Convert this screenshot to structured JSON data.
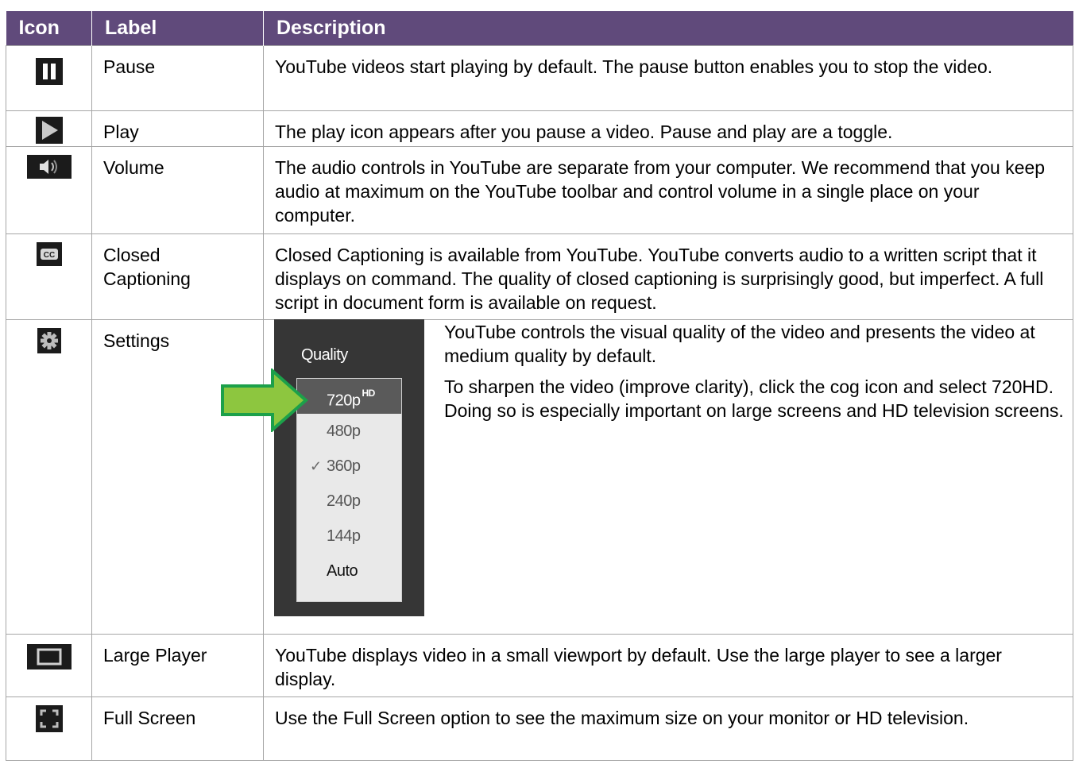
{
  "header": {
    "icon": "Icon",
    "label": "Label",
    "description": "Description"
  },
  "rows": [
    {
      "icon": "pause-icon",
      "label": "Pause",
      "description": "YouTube videos start playing by default. The pause button enables you to stop the video."
    },
    {
      "icon": "play-icon",
      "label": "Play",
      "description": "The play icon appears after you pause a video. Pause and play are a toggle."
    },
    {
      "icon": "volume-icon",
      "label": "Volume",
      "description": "The audio controls in YouTube are separate from your computer. We recommend that you keep audio at maximum on the YouTube toolbar and control volume in a single place on your computer."
    },
    {
      "icon": "closed-caption-icon",
      "label": "Closed Captioning",
      "description": "Closed Captioning is available from YouTube. YouTube converts audio to a written script that it displays on command. The quality of closed captioning is surprisingly good, but imperfect. A full script in document form is available on request."
    },
    {
      "icon": "gear-icon",
      "label": "Settings",
      "description_paragraphs": [
        "YouTube controls the visual quality of the video and presents the video at medium quality by default.",
        "To sharpen the video (improve clarity), click the cog icon and select 720HD. Doing so is especially important on large screens and HD television screens."
      ]
    },
    {
      "icon": "large-player-icon",
      "label": "Large Player",
      "description": "YouTube displays video in a small viewport by default. Use the large player to see a larger display."
    },
    {
      "icon": "fullscreen-icon",
      "label": "Full Screen",
      "description": "Use the Full Screen option to see the maximum size on your monitor or HD television."
    }
  ],
  "quality_menu": {
    "title": "Quality",
    "options": [
      {
        "label": "720p",
        "badge": "HD"
      },
      {
        "label": "480p"
      },
      {
        "label": "360p"
      },
      {
        "label": "240p"
      },
      {
        "label": "144p"
      },
      {
        "label": "Auto"
      }
    ],
    "highlighted": "720p",
    "checked": "360p",
    "check_mark": "✓"
  },
  "colors": {
    "header_bg": "#604a7b",
    "border": "#a6a6a6",
    "arrow_fill": "#8dc63f",
    "arrow_stroke": "#1ca04a"
  }
}
